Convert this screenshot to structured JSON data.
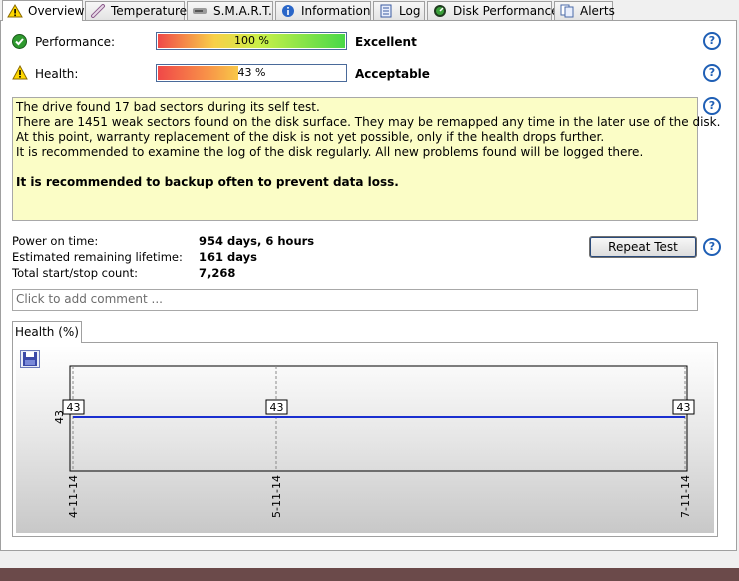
{
  "tabs": [
    {
      "label": "Overview",
      "icon": "warning-icon"
    },
    {
      "label": "Temperature",
      "icon": "thermometer-icon"
    },
    {
      "label": "S.M.A.R.T.",
      "icon": "smart-icon"
    },
    {
      "label": "Information",
      "icon": "info-icon"
    },
    {
      "label": "Log",
      "icon": "log-icon"
    },
    {
      "label": "Disk Performance",
      "icon": "gauge-icon"
    },
    {
      "label": "Alerts",
      "icon": "alerts-icon"
    }
  ],
  "performance": {
    "label": "Performance:",
    "percent_text": "100 %",
    "value": 100,
    "quality": "Excellent"
  },
  "health": {
    "label": "Health:",
    "percent_text": "43 %",
    "value": 43,
    "quality": "Acceptable"
  },
  "message": {
    "lines": [
      "The drive found 17 bad sectors during its self test.",
      "There are 1451 weak sectors found on the disk surface. They may be remapped any time in the later use of the disk.",
      "At this point, warranty replacement of the disk is not yet possible, only if the health drops further.",
      "It is recommended to examine the log of the disk regularly. All new problems found will be logged there."
    ],
    "recommendation": "It is recommended to backup often to prevent data loss."
  },
  "stats": [
    {
      "label": "Power on time:",
      "value": "954 days, 6 hours"
    },
    {
      "label": "Estimated remaining lifetime:",
      "value": "161 days"
    },
    {
      "label": "Total start/stop count:",
      "value": "7,268"
    }
  ],
  "repeat_button": "Repeat Test",
  "comment_placeholder": "Click to add comment ...",
  "chart_tab": "Health (%)",
  "colors": {
    "line": "#1a2fd0",
    "message_bg": "#fbfdc6",
    "accent": "#1f5fb5"
  },
  "chart_data": {
    "type": "line",
    "title": "",
    "xlabel": "",
    "ylabel": "",
    "x": [
      "4-11-14",
      "5-11-14",
      "7-11-14"
    ],
    "series": [
      {
        "values": [
          43,
          43,
          43
        ]
      }
    ],
    "y_tick_labels": [
      "43"
    ],
    "data_labels": [
      "43",
      "43",
      "43"
    ],
    "grid": true
  }
}
